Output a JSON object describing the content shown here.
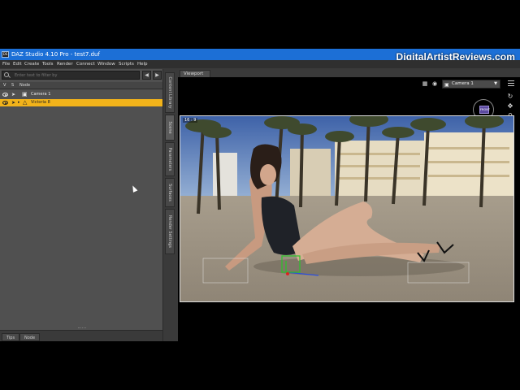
{
  "window": {
    "title": "DAZ Studio 4.10 Pro - test7.duf",
    "app_icon_text": "DS"
  },
  "watermark": "DigitalArtistReviews.com",
  "menubar": {
    "items": [
      "File",
      "Edit",
      "Create",
      "Tools",
      "Render",
      "Connect",
      "Window",
      "Scripts",
      "Help"
    ]
  },
  "scene": {
    "filter_placeholder": "Enter text to filter by",
    "header": {
      "visible": "V",
      "selectable": "S",
      "node": "Node"
    },
    "rows": [
      {
        "label": "Camera 1",
        "icon": "camera-icon",
        "selected": false
      },
      {
        "label": "Victoria 8",
        "icon": "figure-icon",
        "selected": true
      }
    ]
  },
  "left_bottom_tabs": [
    "Tips",
    "Node"
  ],
  "side_tabs": [
    "Content Library",
    "Scene",
    "Parameters",
    "Surfaces",
    "Render Settings"
  ],
  "active_side_tab": "Scene",
  "viewport": {
    "tab_label": "Viewport",
    "camera_select": "Camera 1",
    "aspect_label": "16 : 9",
    "navcube_label": "FRONT"
  },
  "colors": {
    "titlebar": "#1c6fd6",
    "selection": "#f2b31a",
    "panel": "#505050"
  }
}
